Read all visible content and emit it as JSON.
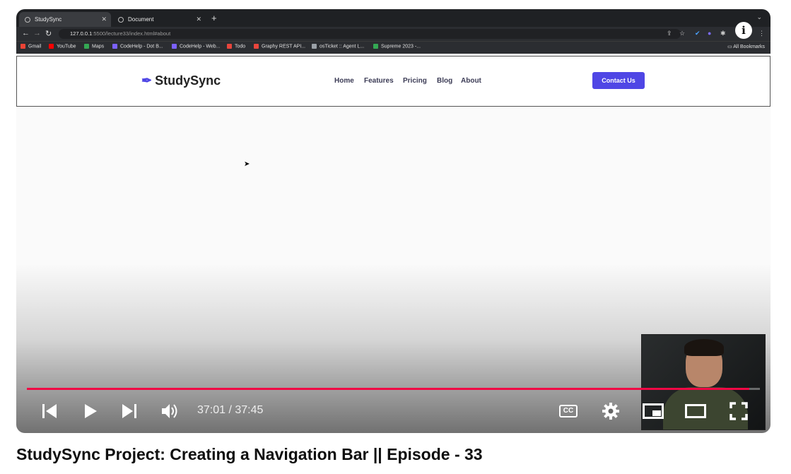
{
  "browser": {
    "tabs": [
      {
        "title": "StudySync"
      },
      {
        "title": "Document"
      }
    ],
    "url_host": "127.0.0.1",
    "url_rest": ":5500/lecture33/index.html#about",
    "bookmarks": [
      {
        "label": "Gmail",
        "color": "#ea4335"
      },
      {
        "label": "YouTube",
        "color": "#ff0000"
      },
      {
        "label": "Maps",
        "color": "#34a853"
      },
      {
        "label": "CodeHelp - Dot B...",
        "color": "#7b61ff"
      },
      {
        "label": "CodeHelp - Web...",
        "color": "#7b61ff"
      },
      {
        "label": "Todo",
        "color": "#e8453c"
      },
      {
        "label": "Graphy REST API...",
        "color": "#e8453c"
      },
      {
        "label": "osTicket :: Agent L...",
        "color": "#9aa0a6"
      },
      {
        "label": "Supreme 2023 -...",
        "color": "#34a853"
      }
    ],
    "all_bookmarks": "All Bookmarks"
  },
  "site": {
    "logo": "StudySync",
    "nav": [
      "Home",
      "Features",
      "Pricing",
      "Blog",
      "About"
    ],
    "cta": "Contact Us",
    "accent": "#4f46e5"
  },
  "player": {
    "time": "37:01 / 37:45",
    "progress_fraction": 0.986,
    "cc_label": "CC",
    "progress_color": "#f00845",
    "info_icon": "i"
  },
  "video_title": "StudySync Project: Creating a Navigation Bar || Episode - 33"
}
